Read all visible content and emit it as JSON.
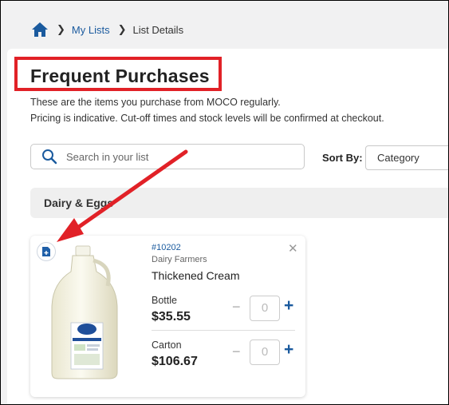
{
  "breadcrumb": {
    "home_icon": "home-icon",
    "items": [
      "My Lists",
      "List Details"
    ]
  },
  "page": {
    "title": "Frequent Purchases",
    "description_line1": "These are the items you purchase from MOCO regularly.",
    "description_line2": "Pricing is indicative. Cut-off times and stock levels will be confirmed at checkout."
  },
  "search": {
    "placeholder": "Search in your list",
    "icon": "search-icon"
  },
  "sort": {
    "label": "Sort By:",
    "selected": "Category"
  },
  "category": {
    "title": "Dairy & Eggs"
  },
  "product": {
    "sku": "#10202",
    "brand": "Dairy Farmers",
    "name": "Thickened Cream",
    "close_icon": "close-icon",
    "doc_icon": "add-note-icon",
    "variants": [
      {
        "label": "Bottle",
        "price": "$35.55",
        "quantity": "0",
        "minus": "−",
        "plus": "+"
      },
      {
        "label": "Carton",
        "price": "$106.67",
        "quantity": "0",
        "minus": "−",
        "plus": "+"
      }
    ]
  },
  "colors": {
    "accent": "#1a5a9e",
    "highlight": "#e12127"
  }
}
